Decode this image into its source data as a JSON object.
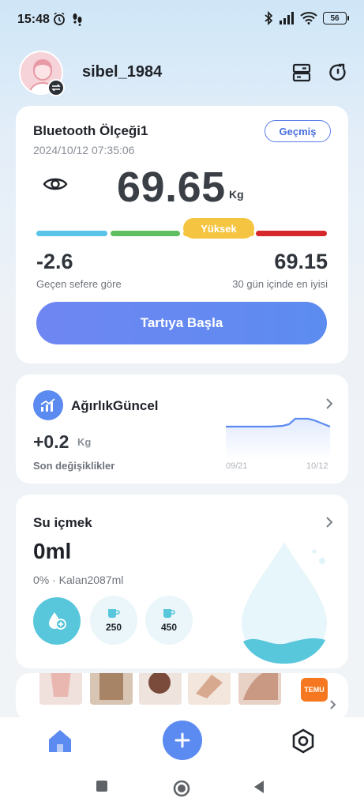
{
  "status_bar": {
    "time": "15:48",
    "battery": "56",
    "left_icons": [
      "alarm-icon",
      "steps-icon"
    ],
    "right_icons": [
      "bluetooth-icon",
      "signal-icon",
      "wifi-icon",
      "battery-icon"
    ]
  },
  "header": {
    "username": "sibel_1984",
    "icons": [
      "devices-icon",
      "refresh-icon"
    ]
  },
  "scale_card": {
    "device_name": "Bluetooth Ölçeği1",
    "datetime": "2024/10/12 07:35:06",
    "history_label": "Geçmiş",
    "weight": "69.65",
    "unit": "Kg",
    "bmi_status": "Yüksek",
    "bar_colors": [
      "#5bc3e8",
      "#5fbf60",
      "#f5c542",
      "#d6272a"
    ],
    "diff_value": "-2.6",
    "diff_label": "Geçen sefere göre",
    "best_value": "69.15",
    "best_label": "30 gün içinde en iyisi",
    "start_label": "Tartıya Başla"
  },
  "trend_card": {
    "title": "AğırlıkGüncel",
    "delta": "+0.2",
    "unit": "Kg",
    "label": "Son değişiklikler",
    "x_start": "09/21",
    "x_end": "10/12",
    "line_color": "#5b8af0"
  },
  "water_card": {
    "title": "Su içmek",
    "amount": "0ml",
    "subtitle": "0% · Kalan2087ml",
    "cups": [
      "250",
      "450"
    ],
    "accent": "#58c7dc"
  },
  "ad": {
    "brand": "TEMU",
    "info_icon": "i",
    "close_icon": "✕"
  },
  "bottom_nav": {
    "items": [
      "home-icon",
      "add-icon",
      "settings-icon"
    ]
  },
  "system_nav": {
    "items": [
      "recents-button",
      "home-button",
      "back-button"
    ]
  }
}
